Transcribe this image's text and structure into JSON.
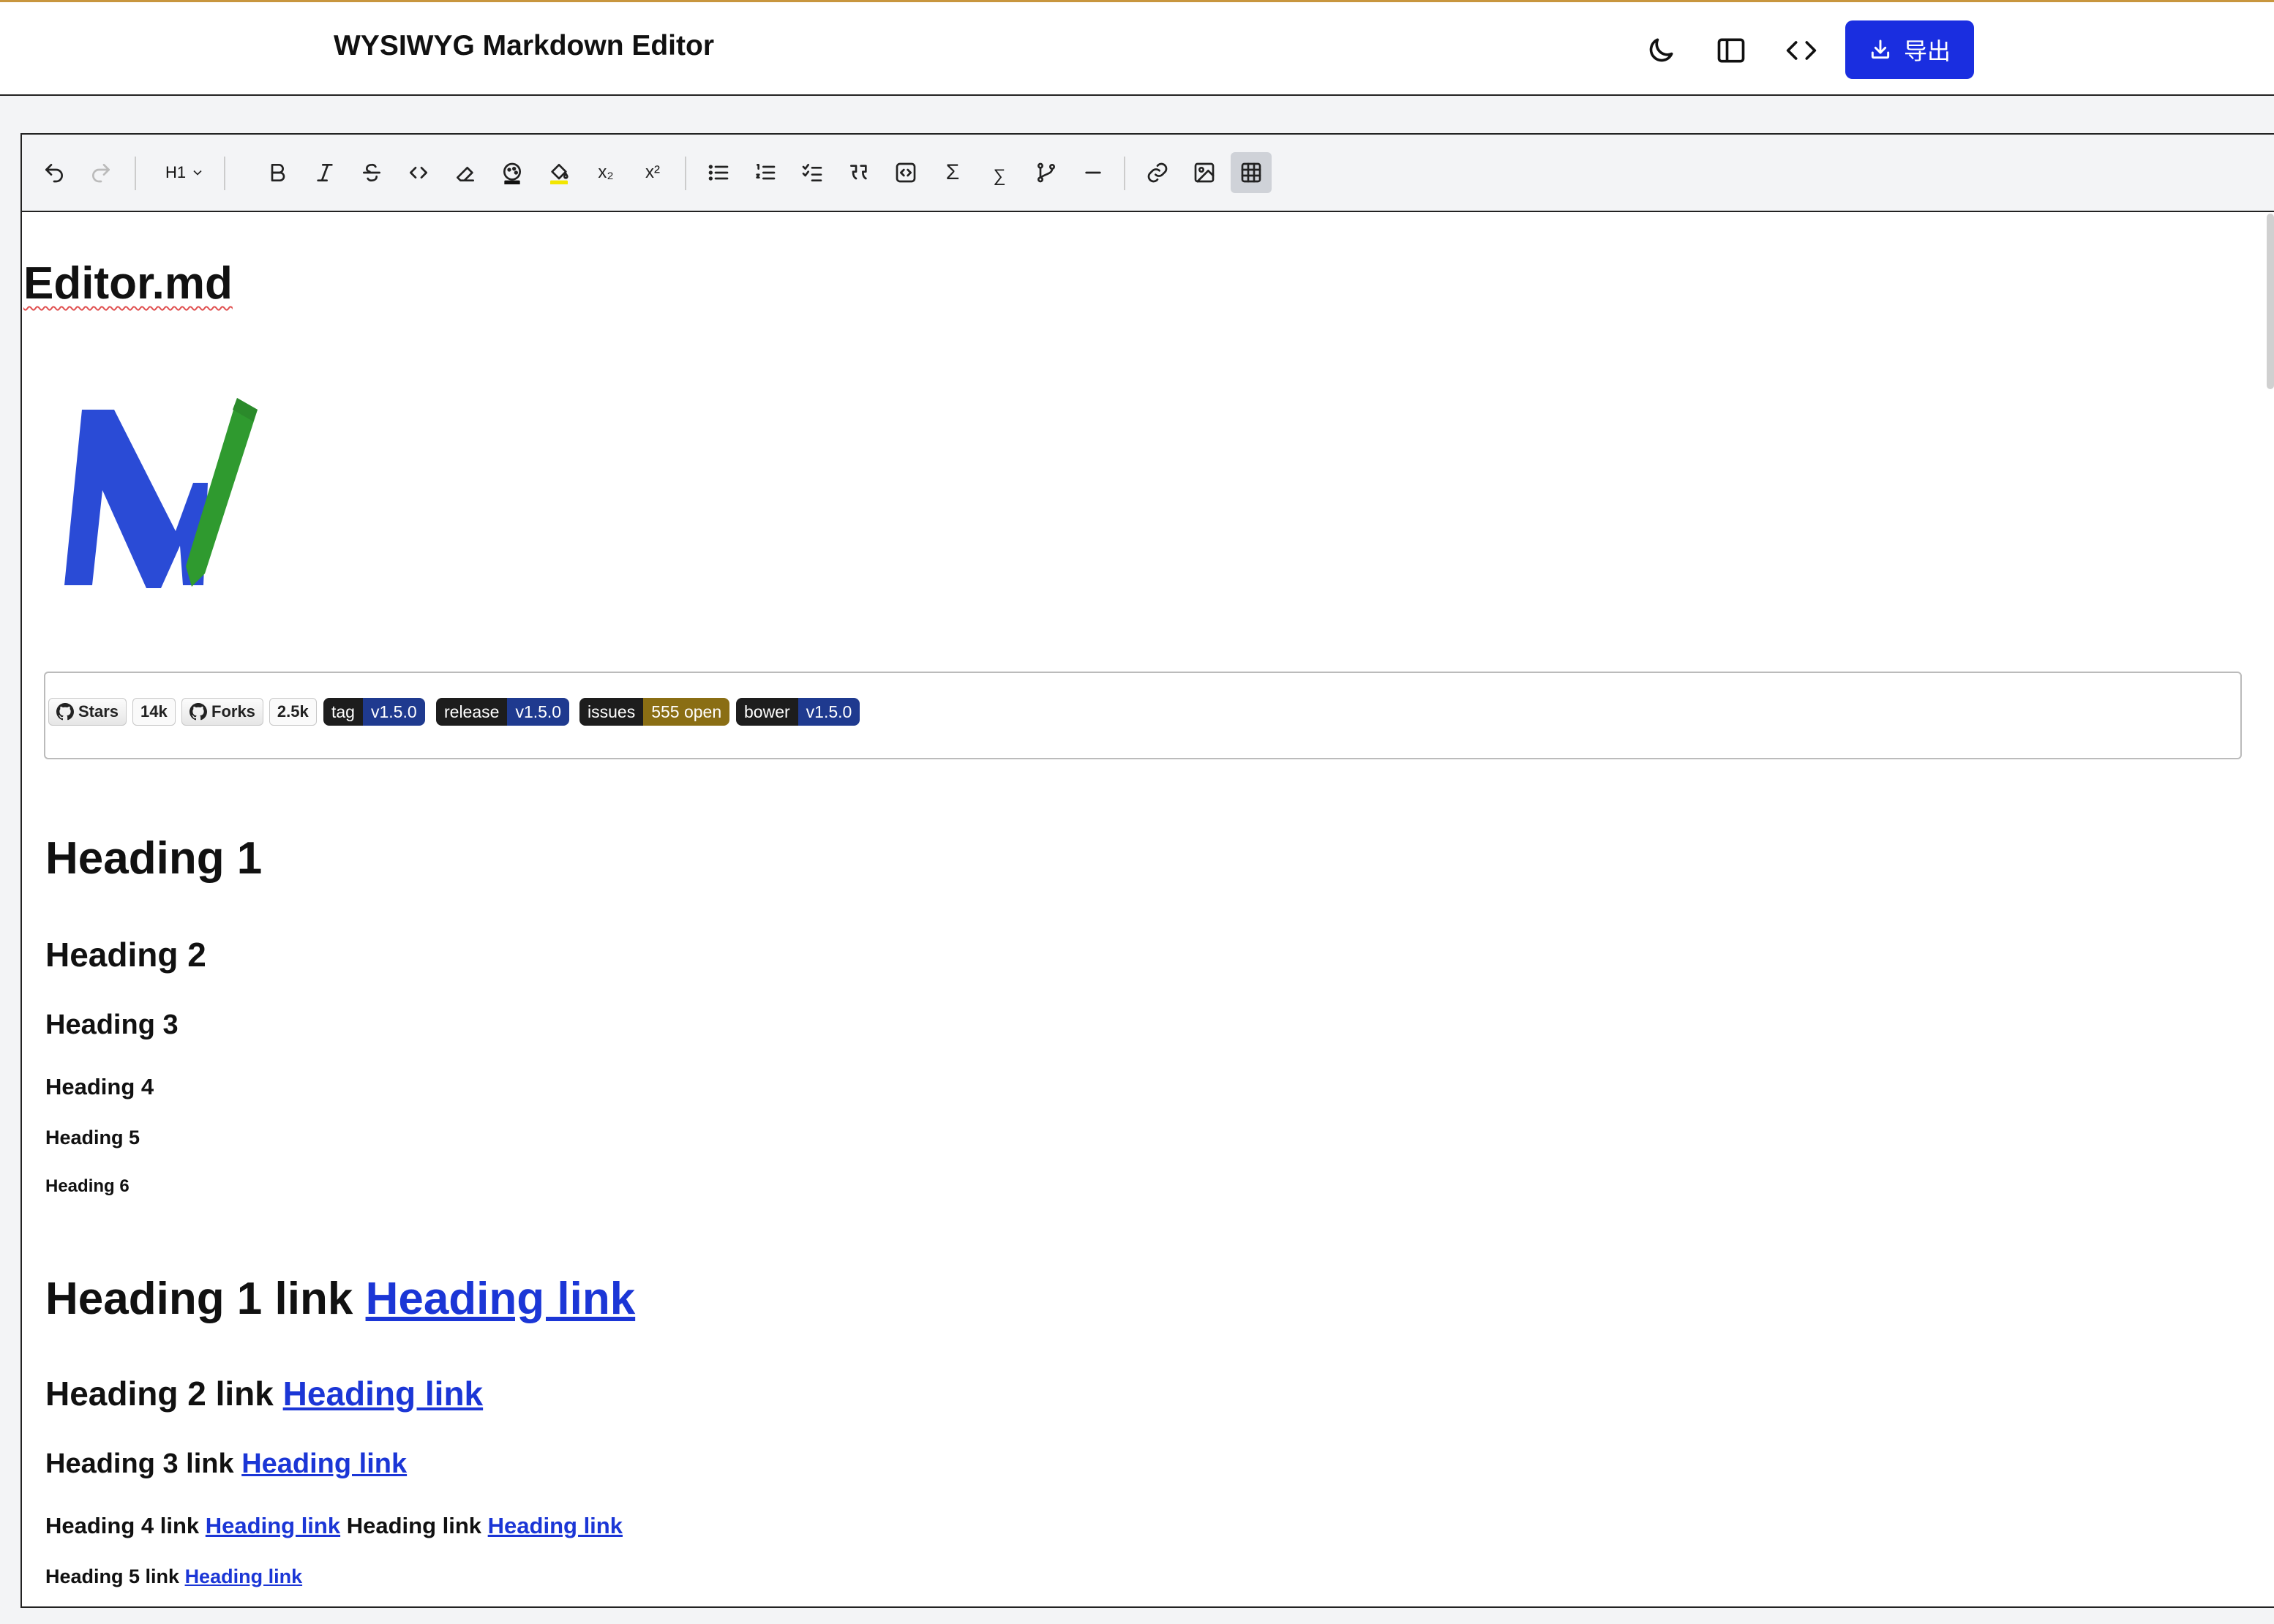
{
  "header": {
    "title": "WYSIWYG Markdown Editor",
    "export_label": "导出",
    "icons": [
      "moon-icon",
      "sidebar-icon",
      "code-icon",
      "download-icon"
    ]
  },
  "toolbar": {
    "heading_select": "H1",
    "buttons": [
      "undo",
      "redo",
      "bold",
      "italic",
      "strikethrough",
      "inline-code",
      "clear-format",
      "text-color",
      "highlight",
      "subscript",
      "superscript",
      "bullet-list",
      "ordered-list",
      "task-list",
      "blockquote",
      "code-block",
      "math-block",
      "inline-math",
      "mermaid",
      "horizontal-rule",
      "link",
      "image",
      "table"
    ],
    "subscript_label": "x₂",
    "superscript_label": "x²",
    "math_label": "Σ",
    "inline_math_label": "∑"
  },
  "document": {
    "title": "Editor.md",
    "badges": {
      "stars_label": "Stars",
      "stars_count": "14k",
      "forks_label": "Forks",
      "forks_count": "2.5k",
      "tag": {
        "left": "tag",
        "right": "v1.5.0"
      },
      "release": {
        "left": "release",
        "right": "v1.5.0"
      },
      "issues": {
        "left": "issues",
        "right": "555 open"
      },
      "bower": {
        "left": "bower",
        "right": "v1.5.0"
      }
    },
    "headings": [
      "Heading 1",
      "Heading 2",
      "Heading 3",
      "Heading 4",
      "Heading 5",
      "Heading 6"
    ],
    "heading_links": {
      "h1_text": "Heading 1 link",
      "h2_text": "Heading 2 link",
      "h3_text": "Heading 3 link",
      "h4_text": "Heading 4 link",
      "h4_middle": "Heading link",
      "h5_text": "Heading 5 link",
      "link_text": "Heading link"
    }
  },
  "colors": {
    "accent": "#1a2ee0",
    "link": "#1b36d6",
    "badge_dark": "#1d1d1d",
    "badge_blue": "#1f3a8f",
    "badge_olive": "#8a6e14"
  }
}
